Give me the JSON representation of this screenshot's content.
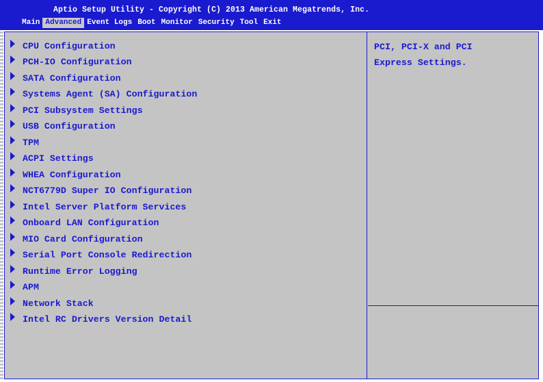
{
  "header": {
    "title": "Aptio Setup Utility - Copyright (C) 2013 American Megatrends, Inc.",
    "menu": [
      "Main",
      "Advanced",
      "Event Logs",
      "Boot",
      "Monitor",
      "Security",
      "Tool",
      "Exit"
    ],
    "active_menu": "Advanced"
  },
  "items": [
    "CPU Configuration",
    "PCH-IO Configuration",
    "SATA Configuration",
    "Systems Agent (SA) Configuration",
    "PCI Subsystem Settings",
    "USB Configuration",
    "TPM",
    "ACPI Settings",
    "WHEA Configuration",
    "NCT6779D Super IO Configuration",
    "Intel Server Platform Services",
    "Onboard LAN Configuration",
    "MIO Card Configuration",
    "Serial Port Console Redirection",
    "Runtime Error Logging",
    "APM",
    "Network Stack",
    "Intel RC Drivers Version Detail"
  ],
  "help": {
    "lines": [
      "PCI, PCI-X and PCI",
      "Express Settings."
    ]
  },
  "colors": {
    "header_bg": "#1a1acf",
    "text": "#1a1acf",
    "panel_bg": "#c4c4c4"
  }
}
